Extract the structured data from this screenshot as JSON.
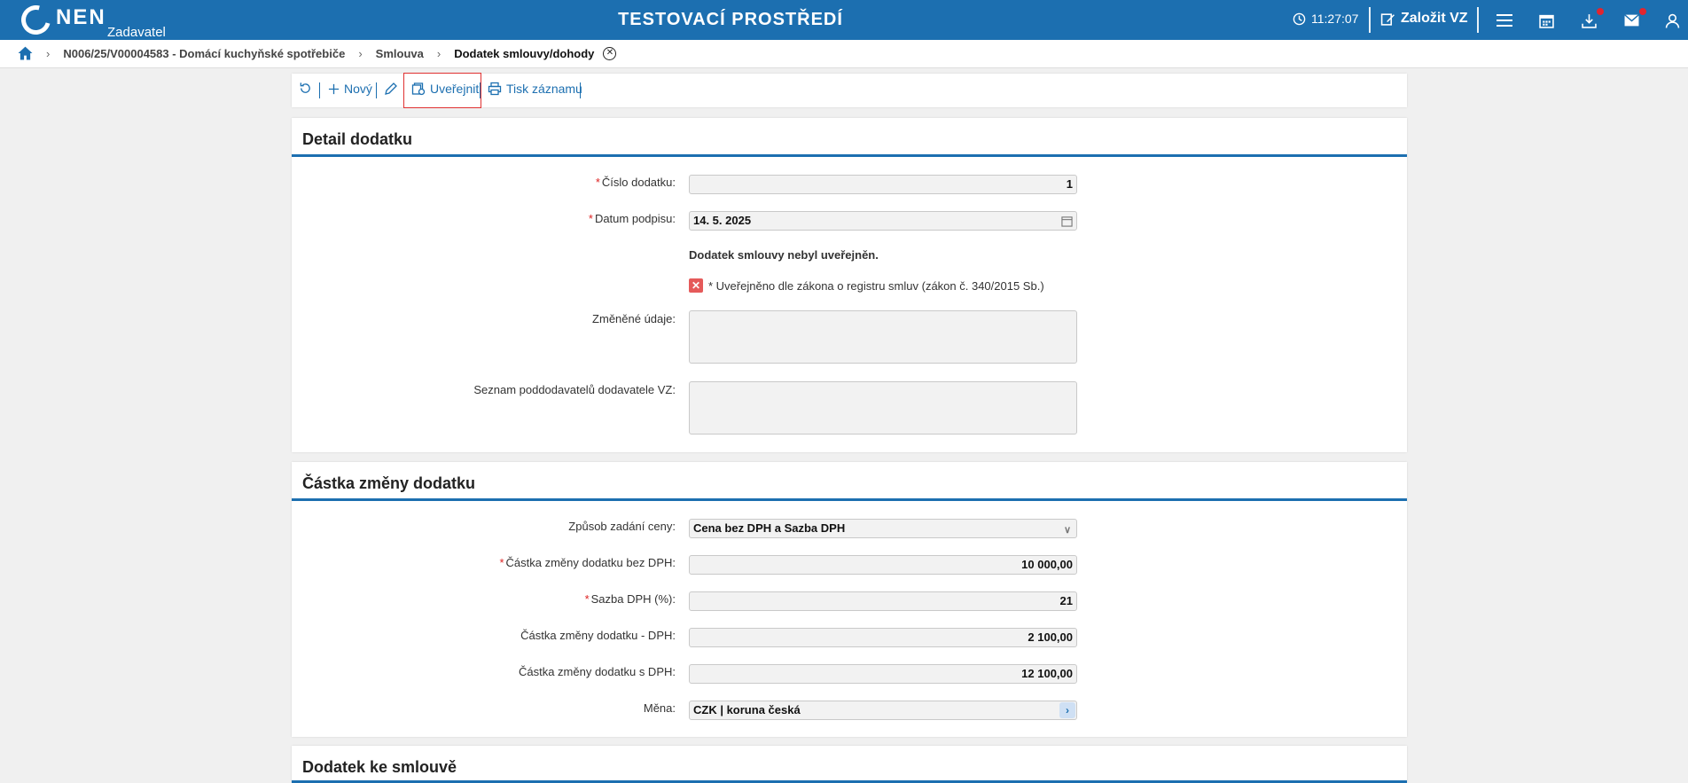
{
  "app": {
    "logo_text": "NEN",
    "logo_sub": "Zadavatel",
    "environment": "TESTOVACÍ PROSTŘEDÍ",
    "time": "11:27:07",
    "create_label": "Založit VZ",
    "icons": [
      "clock-icon",
      "edit-icon",
      "menu-icon",
      "calendar-icon",
      "download-icon",
      "mail-icon",
      "user-icon"
    ],
    "brand_color": "#1c6fb0"
  },
  "breadcrumb": {
    "items": [
      {
        "label": "N006/25/V00004583 - Domácí kuchyňské spotřebiče"
      },
      {
        "label": "Smlouva"
      },
      {
        "label": "Dodatek smlouvy/dohody"
      }
    ]
  },
  "toolbar": {
    "new_label": "Nový",
    "publish_label": "Uveřejnit",
    "print_label": "Tisk záznamu"
  },
  "detail": {
    "title": "Detail dodatku",
    "number_label": "Číslo dodatku:",
    "number_value": "1",
    "sign_date_label": "Datum podpisu:",
    "sign_date_value": "14. 5. 2025",
    "not_published_note": "Dodatek smlouvy nebyl uveřejněn.",
    "register_label": "* Uveřejněno dle zákona o registru smluv (zákon č. 340/2015 Sb.)",
    "register_checked": false,
    "changed_data_label": "Změněné údaje:",
    "changed_data_value": "",
    "subcontractors_label": "Seznam poddodavatelů dodavatele VZ:",
    "subcontractors_value": ""
  },
  "amount": {
    "title": "Částka změny dodatku",
    "price_mode_label": "Způsob zadání ceny:",
    "price_mode_value": "Cena bez DPH a Sazba DPH",
    "without_vat_label": "Částka změny dodatku bez DPH:",
    "without_vat_value": "10 000,00",
    "vat_rate_label": "Sazba DPH (%):",
    "vat_rate_value": "21",
    "vat_label": "Částka změny dodatku - DPH:",
    "vat_value": "2 100,00",
    "with_vat_label": "Částka změny dodatku s DPH:",
    "with_vat_value": "12 100,00",
    "currency_label": "Měna:",
    "currency_value": "CZK | koruna česká"
  },
  "attachment": {
    "title": "Dodatek ke smlouvě"
  }
}
